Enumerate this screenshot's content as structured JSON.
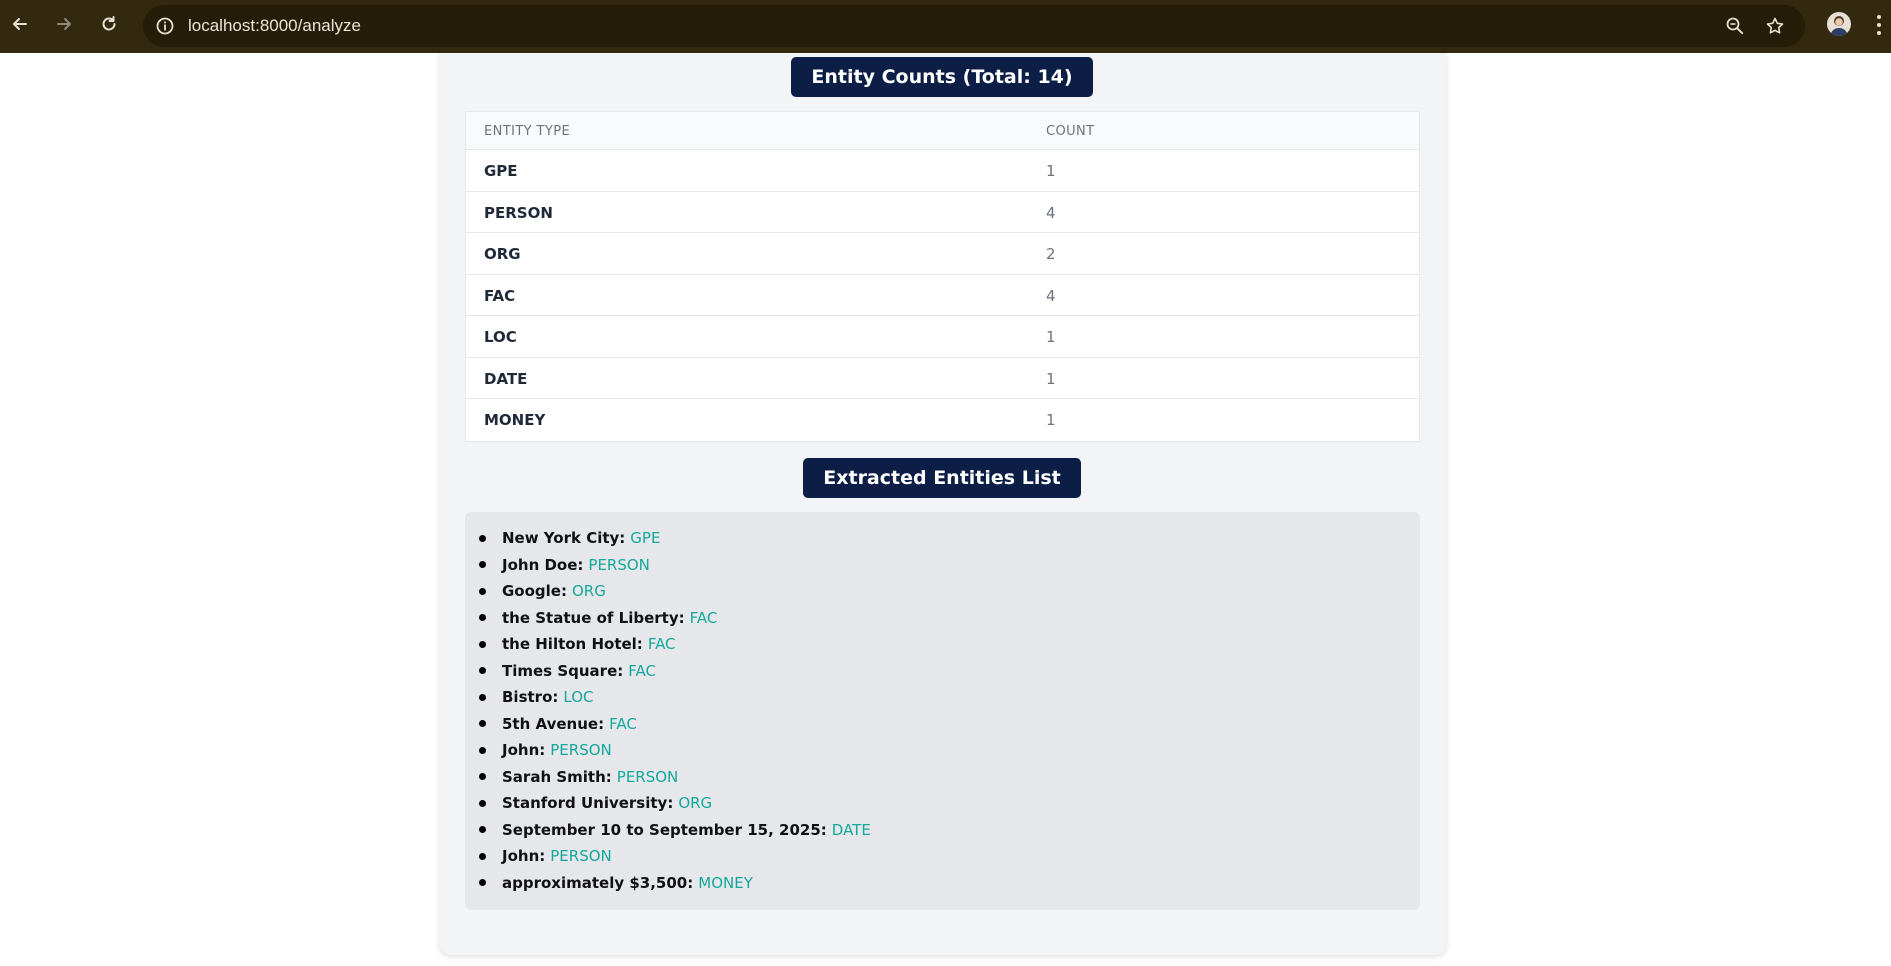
{
  "browser": {
    "url": "localhost:8000/analyze"
  },
  "counts_section": {
    "title": "Entity Counts (Total: 14)",
    "headers": {
      "type": "ENTITY TYPE",
      "count": "COUNT"
    },
    "rows": [
      {
        "type": "GPE",
        "count": "1"
      },
      {
        "type": "PERSON",
        "count": "4"
      },
      {
        "type": "ORG",
        "count": "2"
      },
      {
        "type": "FAC",
        "count": "4"
      },
      {
        "type": "LOC",
        "count": "1"
      },
      {
        "type": "DATE",
        "count": "1"
      },
      {
        "type": "MONEY",
        "count": "1"
      }
    ]
  },
  "list_section": {
    "title": "Extracted Entities List",
    "items": [
      {
        "text": "New York City:",
        "label": "GPE"
      },
      {
        "text": "John Doe:",
        "label": "PERSON"
      },
      {
        "text": "Google:",
        "label": "ORG"
      },
      {
        "text": "the Statue of Liberty:",
        "label": "FAC"
      },
      {
        "text": "the Hilton Hotel:",
        "label": "FAC"
      },
      {
        "text": "Times Square:",
        "label": "FAC"
      },
      {
        "text": "Bistro:",
        "label": "LOC"
      },
      {
        "text": "5th Avenue:",
        "label": "FAC"
      },
      {
        "text": "John:",
        "label": "PERSON"
      },
      {
        "text": "Sarah Smith:",
        "label": "PERSON"
      },
      {
        "text": "Stanford University:",
        "label": "ORG"
      },
      {
        "text": "September 10 to September 15, 2025:",
        "label": "DATE"
      },
      {
        "text": "John:",
        "label": "PERSON"
      },
      {
        "text": "approximately $3,500:",
        "label": "MONEY"
      }
    ]
  },
  "colors": {
    "chrome": "#33290f",
    "pill_bg": "#0c1e45",
    "label_teal": "#14a89a"
  },
  "icons": [
    "back-arrow-icon",
    "forward-arrow-icon",
    "reload-icon",
    "site-info-icon",
    "zoom-icon",
    "bookmark-star-icon",
    "profile-avatar",
    "menu-dots-icon"
  ]
}
